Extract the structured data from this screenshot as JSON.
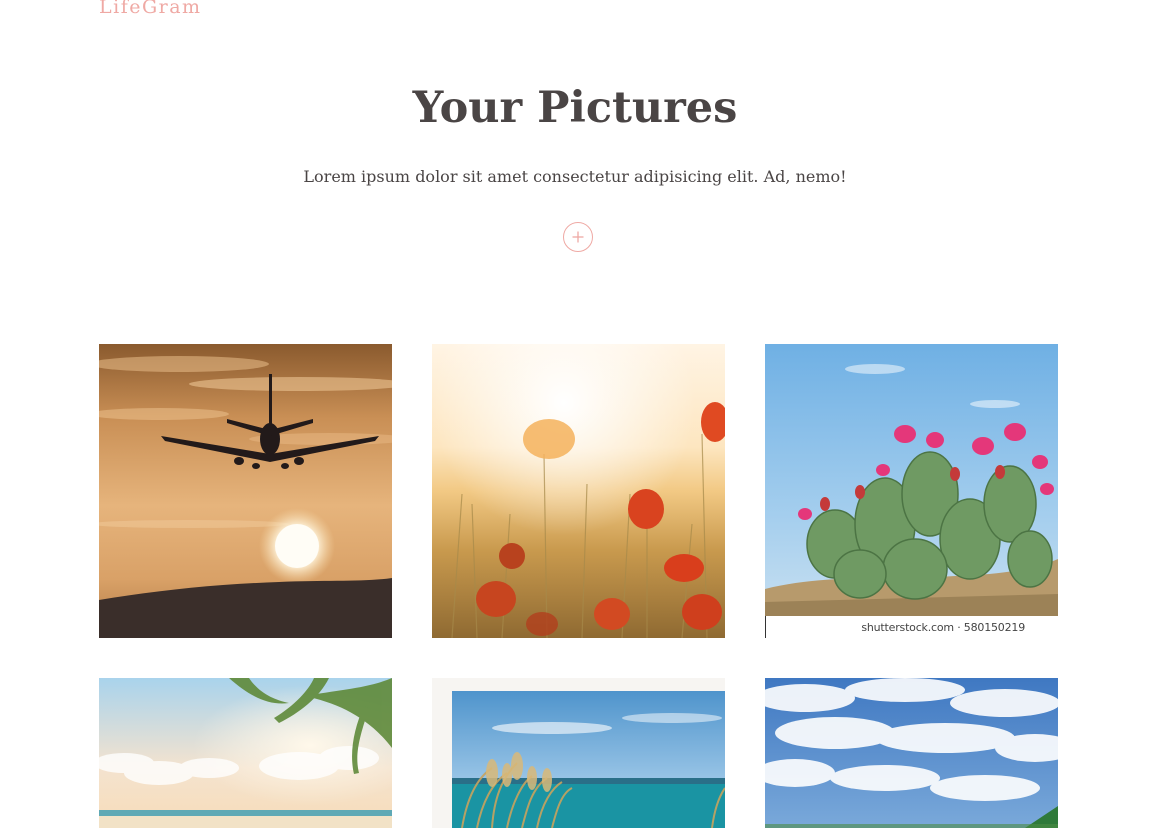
{
  "brand": {
    "name": "LifeGram"
  },
  "hero": {
    "title": "Your Pictures",
    "subtitle": "Lorem ipsum dolor sit amet consectetur adipisicing elit. Ad, nemo!"
  },
  "add_button": {
    "icon": "plus-icon",
    "symbol": "+"
  },
  "colors": {
    "accent": "#efa9a4",
    "heading": "#4a4545",
    "background": "#ffffff"
  },
  "gallery": {
    "photos": [
      {
        "subject": "airplane-sunset",
        "icon": "photo"
      },
      {
        "subject": "poppy-field",
        "icon": "photo"
      },
      {
        "subject": "blooming-cactus",
        "icon": "photo",
        "watermark": "shutterstock.com · 580150219"
      },
      {
        "subject": "tropical-beach",
        "icon": "photo"
      },
      {
        "subject": "dune-grass-sea",
        "icon": "photo"
      },
      {
        "subject": "cloudy-sky",
        "icon": "photo"
      }
    ]
  }
}
